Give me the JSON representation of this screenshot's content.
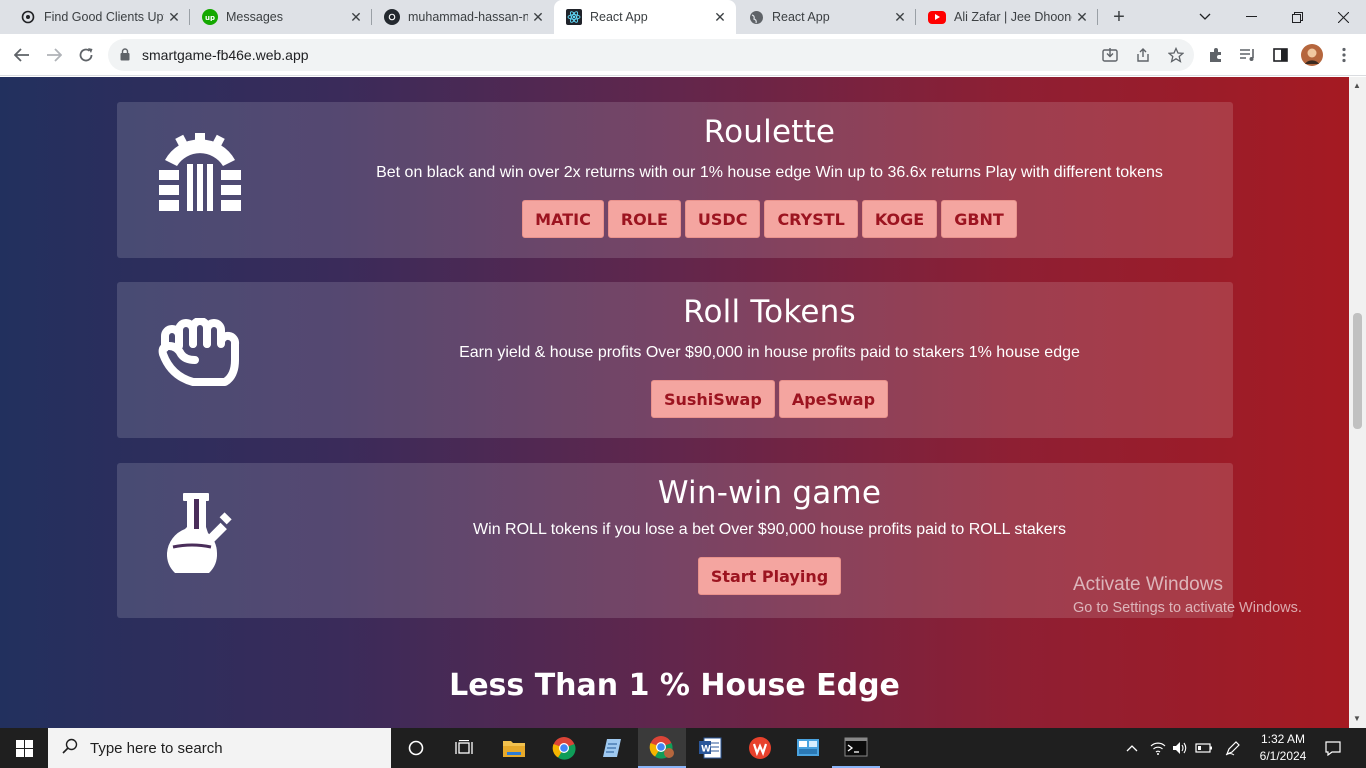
{
  "browser": {
    "tabs": [
      {
        "title": "Find Good Clients Upv",
        "icon": "openai-icon"
      },
      {
        "title": "Messages",
        "icon": "upwork-icon"
      },
      {
        "title": "muhammad-hassan-n",
        "icon": "github-icon"
      },
      {
        "title": "React App",
        "icon": "react-icon",
        "active": true
      },
      {
        "title": "React App",
        "icon": "globe-icon"
      },
      {
        "title": "Ali Zafar | Jee Dhoond",
        "icon": "youtube-icon"
      }
    ],
    "url": "smartgame-fb46e.web.app"
  },
  "cards": [
    {
      "title": "Roulette",
      "description": "Bet on black and win over 2x returns with our 1% house edge Win up to 36.6x returns Play with different tokens",
      "icon": "roulette-wheel-icon",
      "buttons": [
        "MATIC",
        "ROLE",
        "USDC",
        "CRYSTL",
        "KOGE",
        "GBNT"
      ]
    },
    {
      "title": "Roll Tokens",
      "description": "Earn yield & house profits Over $90,000 in house profits paid to stakers 1% house edge",
      "icon": "fist-icon",
      "buttons": [
        "SushiSwap",
        "ApeSwap"
      ]
    },
    {
      "title": "Win-win game",
      "description": "Win ROLL tokens if you lose a bet Over $90,000 house profits paid to ROLL stakers",
      "icon": "flask-icon",
      "buttons": [
        "Start Playing"
      ]
    }
  ],
  "section_title": "Less Than 1 % House Edge",
  "watermark": {
    "line1": "Activate Windows",
    "line2": "Go to Settings to activate Windows."
  },
  "taskbar": {
    "search_placeholder": "Type here to search",
    "time": "1:32 AM",
    "date": "6/1/2024"
  },
  "colors": {
    "button_bg": "#f4a5a0",
    "button_text": "#9c1420",
    "gradient_left": "#22305e",
    "gradient_right": "#a51a22"
  }
}
